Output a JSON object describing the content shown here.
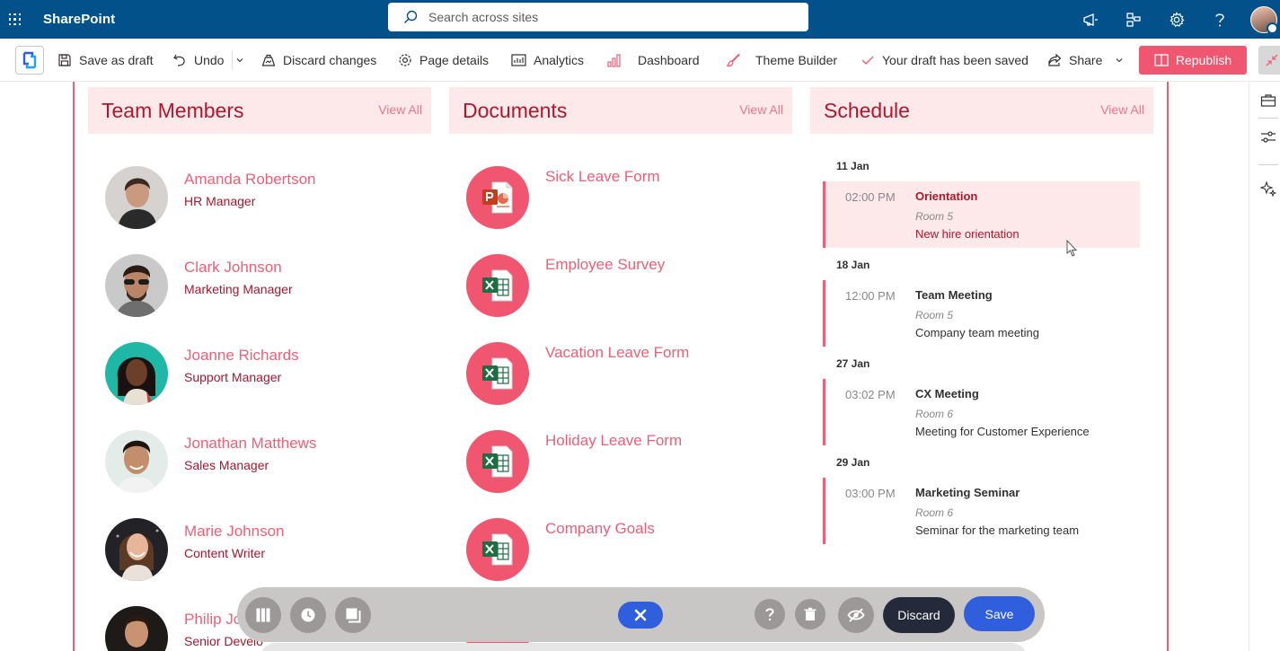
{
  "suite_bar": {
    "app_name": "SharePoint",
    "search_placeholder": "Search across sites",
    "icons": [
      "megaphone-icon",
      "org-chart-icon",
      "gear-icon",
      "help-icon",
      "user-avatar"
    ]
  },
  "command_bar": {
    "save_as_draft": "Save as draft",
    "undo": "Undo",
    "discard_changes": "Discard changes",
    "page_details": "Page details",
    "analytics": "Analytics",
    "dashboard": "Dashboard",
    "theme_builder": "Theme Builder",
    "draft_status": "Your draft has been saved",
    "share": "Share",
    "republish": "Republish"
  },
  "colors": {
    "suite_bar": "#03518a",
    "accent": "#ee5f76",
    "accent_dark": "#b0172c",
    "header_bg": "#fde8ea",
    "save_blue": "#2f5fdc",
    "discard_dark": "#252a3a"
  },
  "team_members": {
    "title": "Team Members",
    "view_all": "View All",
    "members": [
      {
        "name": "Amanda Robertson",
        "role": "HR Manager"
      },
      {
        "name": "Clark Johnson",
        "role": "Marketing Manager"
      },
      {
        "name": "Joanne Richards",
        "role": "Support Manager"
      },
      {
        "name": "Jonathan Matthews",
        "role": "Sales Manager"
      },
      {
        "name": "Marie Johnson",
        "role": "Content Writer"
      },
      {
        "name": "Philip Jo",
        "role": "Senior Develo"
      }
    ]
  },
  "documents": {
    "title": "Documents",
    "view_all": "View All",
    "items": [
      {
        "name": "Sick Leave Form",
        "icon": "powerpoint-icon"
      },
      {
        "name": "Employee Survey",
        "icon": "excel-icon"
      },
      {
        "name": "Vacation Leave Form",
        "icon": "excel-icon"
      },
      {
        "name": "Holiday Leave Form",
        "icon": "excel-icon"
      },
      {
        "name": "Company Goals",
        "icon": "excel-icon"
      }
    ]
  },
  "schedule": {
    "title": "Schedule",
    "view_all": "View All",
    "days": [
      {
        "date": "11 Jan",
        "time": "02:00 PM",
        "title": "Orientation",
        "room": "Room 5",
        "description": "New hire orientation"
      },
      {
        "date": "18 Jan",
        "time": "12:00 PM",
        "title": "Team Meeting",
        "room": "Room 5",
        "description": "Company team meeting"
      },
      {
        "date": "27 Jan",
        "time": "03:02 PM",
        "title": "CX Meeting",
        "room": "Room 6",
        "description": "Meeting for Customer Experience"
      },
      {
        "date": "29 Jan",
        "time": "03:00 PM",
        "title": "Marketing Seminar",
        "room": "Room 6",
        "description": "Seminar for the marketing team"
      }
    ]
  },
  "floating_toolbar": {
    "discard": "Discard",
    "save": "Save",
    "icons": [
      "columns-icon",
      "clock-icon",
      "copy-icon",
      "close-icon",
      "help-icon",
      "trash-icon",
      "hide-icon"
    ]
  }
}
